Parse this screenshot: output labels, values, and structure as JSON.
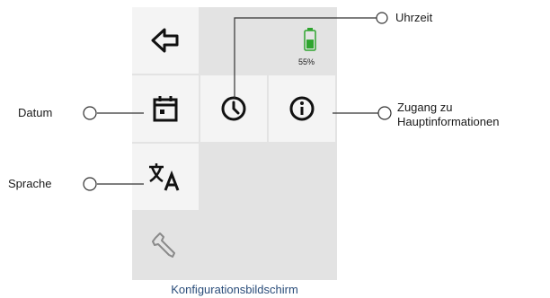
{
  "screen": {
    "battery": {
      "percent_label": "55%",
      "level": 0.55,
      "color": "#2fa52f"
    },
    "buttons": [
      {
        "id": "back",
        "icon": "back-arrow-icon"
      },
      {
        "id": "date",
        "icon": "calendar-icon"
      },
      {
        "id": "time",
        "icon": "clock-icon"
      },
      {
        "id": "info",
        "icon": "info-icon"
      },
      {
        "id": "language",
        "icon": "translate-icon"
      },
      {
        "id": "tools",
        "icon": "wrench-icon"
      }
    ]
  },
  "callouts": {
    "uhrzeit": "Uhrzeit",
    "datum": "Datum",
    "zugang_line1": "Zugang zu",
    "zugang_line2": "Hauptinformationen",
    "sprache": "Sprache"
  },
  "caption": "Konfigurationsbildschirm",
  "colors": {
    "caption": "#2a4d7a",
    "screen_bg": "#e3e3e3",
    "tile_bg": "#f4f4f4"
  }
}
